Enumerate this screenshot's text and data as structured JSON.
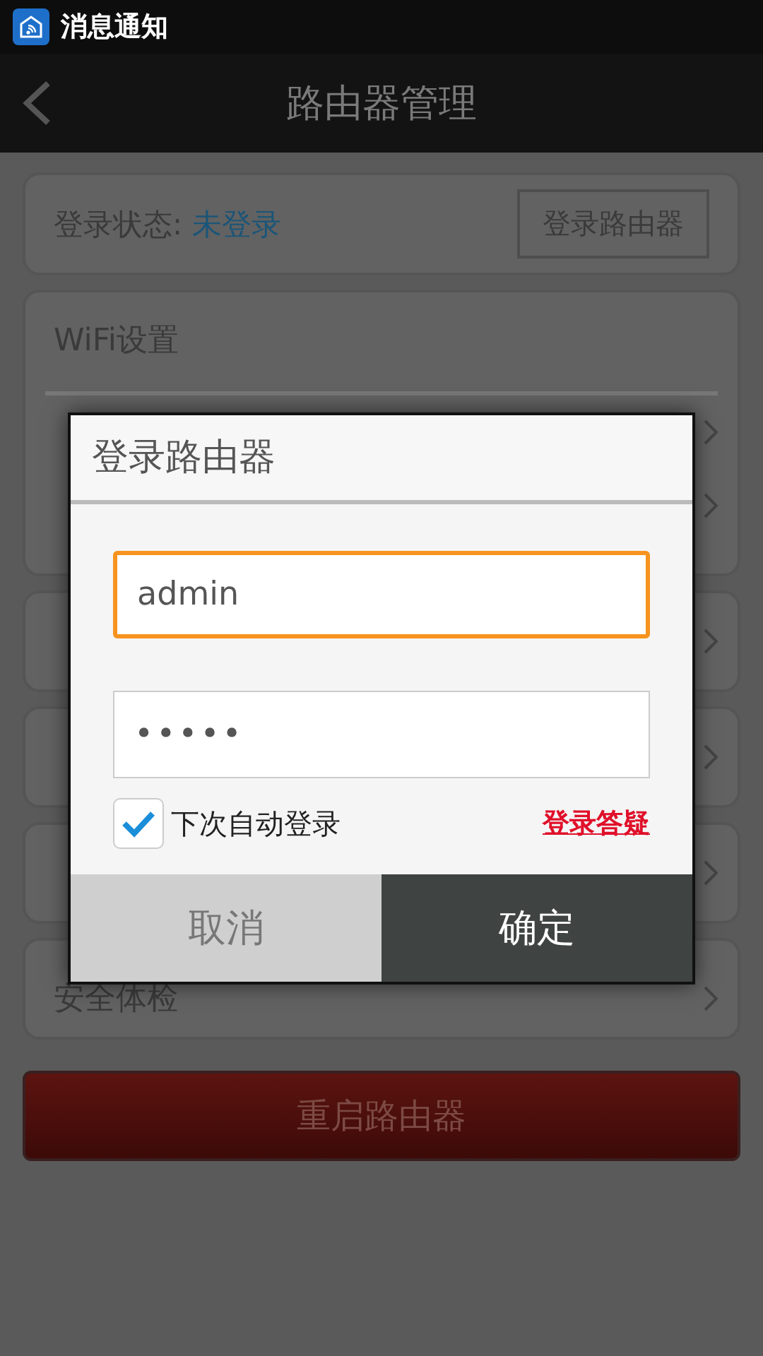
{
  "status_bar": {
    "title": "消息通知"
  },
  "header": {
    "title": "路由器管理"
  },
  "login_card": {
    "label": "登录状态:",
    "status": "未登录",
    "button": "登录路由器"
  },
  "wifi_card": {
    "title": "WiFi设置"
  },
  "security_card": {
    "label": "安全体检"
  },
  "restart_button": "重启路由器",
  "dialog": {
    "title": "登录路由器",
    "username": {
      "value": "admin",
      "focused": true
    },
    "password": {
      "value": "•••••",
      "focused": false
    },
    "auto_login": {
      "label": "下次自动登录",
      "checked": true
    },
    "help_link": "登录答疑",
    "buttons": [
      {
        "label": "取消",
        "kind": "cancel"
      },
      {
        "label": "确定",
        "kind": "confirm"
      }
    ]
  }
}
